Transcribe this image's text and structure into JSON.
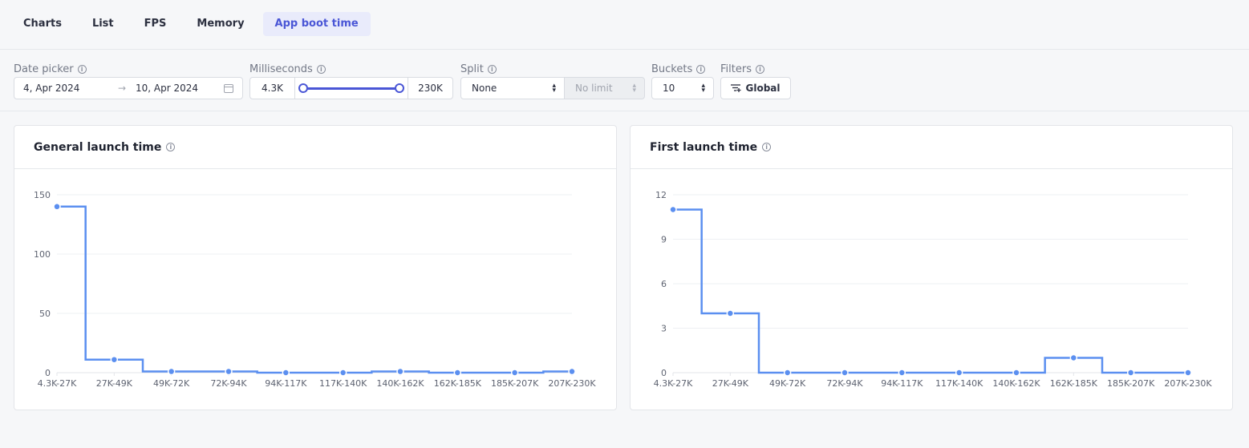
{
  "tabs": [
    {
      "label": "Charts",
      "active": false
    },
    {
      "label": "List",
      "active": false
    },
    {
      "label": "FPS",
      "active": false
    },
    {
      "label": "Memory",
      "active": false
    },
    {
      "label": "App boot time",
      "active": true
    }
  ],
  "filters": {
    "date_picker": {
      "label": "Date picker",
      "start": "4, Apr 2024",
      "end": "10, Apr 2024",
      "separator": "→",
      "icon": "calendar-icon"
    },
    "milliseconds": {
      "label": "Milliseconds",
      "min": "4.3K",
      "max": "230K",
      "range_fraction": [
        0,
        1
      ]
    },
    "split": {
      "label": "Split",
      "value": "None",
      "limit": "No limit"
    },
    "buckets": {
      "label": "Buckets",
      "value": "10"
    },
    "filters": {
      "label": "Filters",
      "button": "Global",
      "icon": "filter-add-icon"
    }
  },
  "colors": {
    "accent": "#4a56d6",
    "series": "#5b8ff0",
    "grid": "#eef0f3"
  },
  "chart_data": [
    {
      "type": "line",
      "step": "center",
      "title": "General launch time",
      "categories": [
        "4.3K-27K",
        "27K-49K",
        "49K-72K",
        "72K-94K",
        "94K-117K",
        "117K-140K",
        "140K-162K",
        "162K-185K",
        "185K-207K",
        "207K-230K"
      ],
      "values": [
        140,
        11,
        1,
        1,
        0,
        0,
        1,
        0,
        0,
        1
      ],
      "yticks": [
        0,
        50,
        100,
        150
      ],
      "ylim": [
        0,
        150
      ],
      "xlabel": "",
      "ylabel": "",
      "grid": true
    },
    {
      "type": "line",
      "step": "center",
      "title": "First launch time",
      "categories": [
        "4.3K-27K",
        "27K-49K",
        "49K-72K",
        "72K-94K",
        "94K-117K",
        "117K-140K",
        "140K-162K",
        "162K-185K",
        "185K-207K",
        "207K-230K"
      ],
      "values": [
        11,
        4,
        0,
        0,
        0,
        0,
        0,
        1,
        0,
        0
      ],
      "yticks": [
        0,
        3,
        6,
        9,
        12
      ],
      "ylim": [
        0,
        12
      ],
      "xlabel": "",
      "ylabel": "",
      "grid": true
    }
  ]
}
